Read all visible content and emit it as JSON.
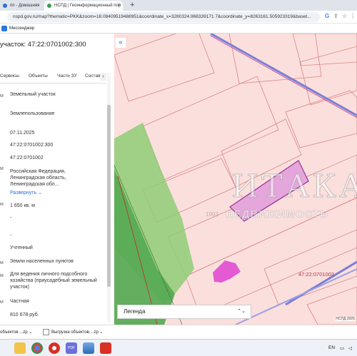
{
  "browser": {
    "tabs": [
      {
        "label": "пп - Домашняя",
        "active": false
      },
      {
        "label": "НСПД | Геоинформационный пор",
        "active": true
      }
    ],
    "new_tab_symbol": "+",
    "url": "nspd.gov.ru/map?thematic=PKK&zoom=18.08409519488951&coordinate_x=3280324.968339171 7&coordinate_y=8263161.505923319&baset...",
    "bookmarks": [
      {
        "label": "Мессенджер"
      }
    ]
  },
  "panel": {
    "title": "участок: 47:22:0701002:300",
    "tabs": [
      "Сервисы",
      "Объекты",
      "Части ЗУ",
      "Состав"
    ],
    "fields": [
      {
        "value": "Земельный участок"
      },
      {
        "value": "Землепользование"
      },
      {
        "value": "07.11.2025"
      },
      {
        "value": "47:22:0701002:300"
      },
      {
        "value": "47:22:0701002"
      },
      {
        "value": "Российская Федерация, Ленинградская область, Ленинградская обл..."
      },
      {
        "value": "Развернуть"
      },
      {
        "value": "1 650 кв. м"
      },
      {
        "value": "-"
      },
      {
        "value": "-"
      },
      {
        "value": "Учтенный"
      },
      {
        "value": "Земли населенных пунктов"
      },
      {
        "value": "Для ведения личного подсобного хозяйства (приусадебный земельный участок)"
      },
      {
        "value": "Частная"
      },
      {
        "value": "810 678 руб."
      }
    ],
    "left_marks": [
      "м",
      "м",
      "м",
      "м",
      "м",
      "м"
    ]
  },
  "map": {
    "cadastral_label": "47:22:0701002",
    "legend_label": "Легенда",
    "copyright": "НСПД 2025",
    "watermark": {
      "brand": "ИТАКА",
      "tagline": "НЕДВИЖИМОСТЬ",
      "year": "1993",
      "registered": "®"
    },
    "colors": {
      "background": "#fbdfdd",
      "parcel_stroke": "#d88585",
      "selected_fill": "#e5a6dc",
      "selected_stroke": "#9b2f95",
      "green_area": "#8fce75",
      "road": "#7a7fd6"
    }
  },
  "downloads": [
    {
      "label": "объектов ...zp"
    },
    {
      "label": "Выгрузка объектов....zp"
    }
  ],
  "taskbar": {
    "language": "EN",
    "icons": [
      "folder-icon",
      "chrome-icon",
      "yandex-icon",
      "pdf-icon",
      "image-viewer-icon",
      "acrobat-icon"
    ]
  }
}
